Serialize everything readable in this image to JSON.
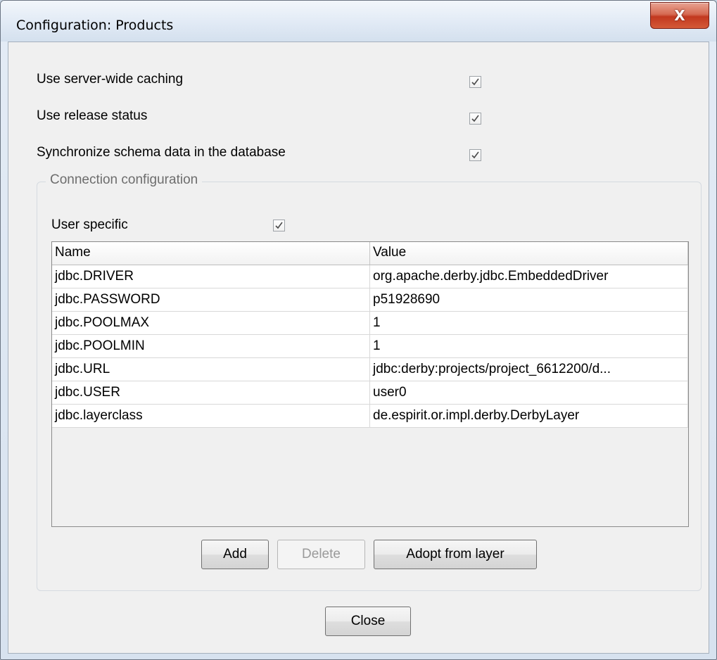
{
  "window": {
    "title": "Configuration: Products",
    "close_glyph": "X"
  },
  "options": [
    {
      "label": "Use server-wide caching",
      "checked": true
    },
    {
      "label": "Use release status",
      "checked": true
    },
    {
      "label": "Synchronize schema data in the database",
      "checked": true
    }
  ],
  "connection": {
    "legend": "Connection configuration",
    "user_specific_label": "User specific",
    "user_specific_checked": true,
    "table": {
      "columns": [
        "Name",
        "Value"
      ],
      "rows": [
        {
          "name": "jdbc.DRIVER",
          "value": "org.apache.derby.jdbc.EmbeddedDriver"
        },
        {
          "name": "jdbc.PASSWORD",
          "value": "p51928690"
        },
        {
          "name": "jdbc.POOLMAX",
          "value": "1"
        },
        {
          "name": "jdbc.POOLMIN",
          "value": "1"
        },
        {
          "name": "jdbc.URL",
          "value": "jdbc:derby:projects/project_6612200/d..."
        },
        {
          "name": "jdbc.USER",
          "value": "user0"
        },
        {
          "name": "jdbc.layerclass",
          "value": "de.espirit.or.impl.derby.DerbyLayer"
        }
      ]
    },
    "buttons": {
      "add": "Add",
      "delete": "Delete",
      "adopt": "Adopt from layer"
    }
  },
  "footer": {
    "close": "Close"
  }
}
